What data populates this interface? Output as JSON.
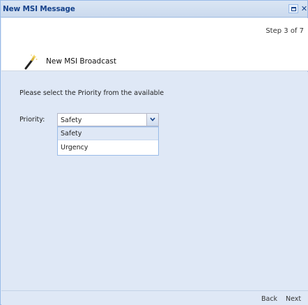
{
  "window": {
    "title": "New MSI Message"
  },
  "header": {
    "step": "Step 3 of 7",
    "title": "New MSI Broadcast",
    "icon": "wand-icon"
  },
  "form": {
    "instruction": "Please select the Priority from the available",
    "priority_label": "Priority:",
    "priority_value": "Safety",
    "options": [
      "Safety",
      "Urgency"
    ],
    "highlighted_option": "Safety"
  },
  "footer": {
    "back_label": "Back",
    "next_label": "Next"
  },
  "colors": {
    "title_text": "#15428b",
    "panel_bg": "#dfe8f6",
    "border": "#99bbe8"
  }
}
